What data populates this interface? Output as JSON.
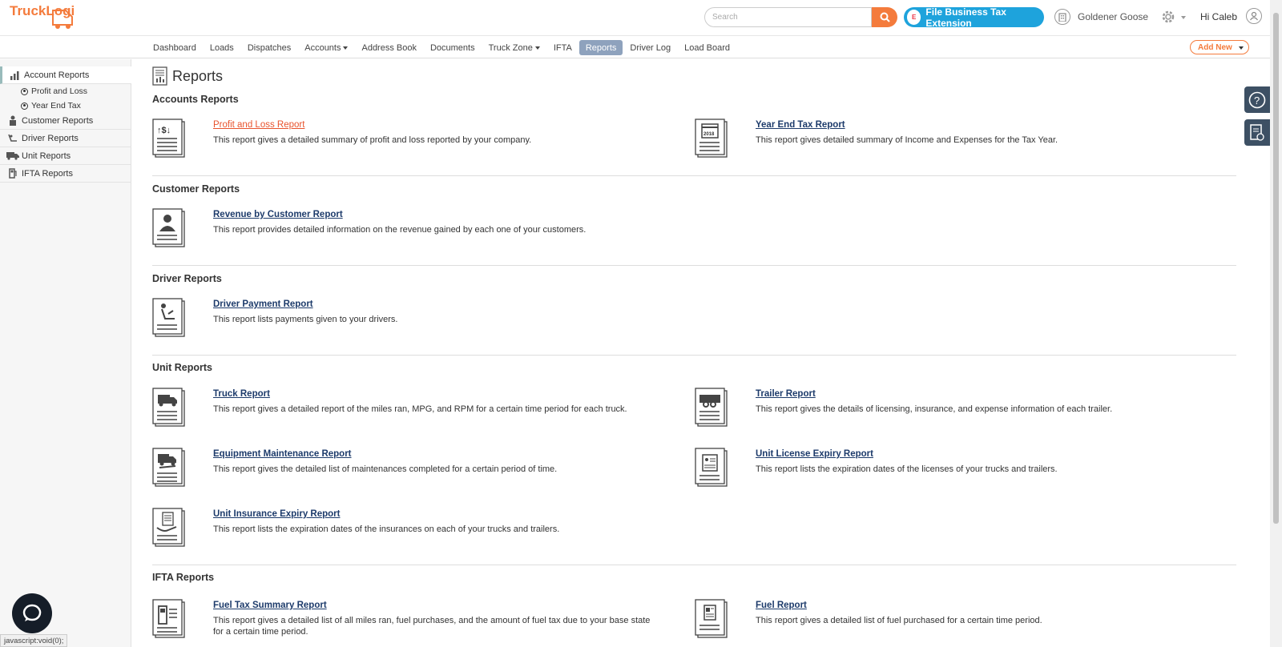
{
  "header": {
    "logo_text": "TruckLogics",
    "search_placeholder": "Search",
    "tax_button": "File Business Tax Extension",
    "tax_logo": "E",
    "company": "Goldener Goose",
    "greeting": "Hi Caleb"
  },
  "nav": {
    "items": [
      "Dashboard",
      "Loads",
      "Dispatches",
      "Accounts",
      "Address Book",
      "Documents",
      "Truck Zone",
      "IFTA",
      "Reports",
      "Driver Log",
      "Load Board"
    ],
    "active": "Reports",
    "add_new": "Add New"
  },
  "sidebar": {
    "items": [
      {
        "label": "Account Reports",
        "icon": "chart-icon"
      },
      {
        "label": "Customer Reports",
        "icon": "person-icon"
      },
      {
        "label": "Driver Reports",
        "icon": "driver-seat-icon"
      },
      {
        "label": "Unit Reports",
        "icon": "truck-icon"
      },
      {
        "label": "IFTA Reports",
        "icon": "fuel-pump-icon"
      }
    ],
    "subitems": [
      "Profit and Loss",
      "Year End Tax"
    ]
  },
  "main": {
    "title": "Reports",
    "sections": [
      {
        "title": "Accounts Reports"
      },
      {
        "title": "Customer Reports"
      },
      {
        "title": "Driver Reports"
      },
      {
        "title": "Unit Reports"
      },
      {
        "title": "IFTA Reports"
      }
    ],
    "reports": [
      {
        "title": "Profit and Loss Report",
        "desc": "This report gives a detailed summary of profit and loss reported by your company."
      },
      {
        "title": "Year End Tax Report",
        "desc": "This report gives detailed summary of Income and Expenses for the Tax Year.",
        "icon_text": "2018"
      },
      {
        "title": "Revenue by Customer Report",
        "desc": "This report provides detailed information on the revenue gained by each one of your customers."
      },
      {
        "title": "Driver Payment Report",
        "desc": "This report lists payments given to your drivers."
      },
      {
        "title": "Truck Report",
        "desc": "This report gives a detailed report of the miles ran, MPG, and RPM for a certain time period for each truck."
      },
      {
        "title": "Trailer Report",
        "desc": "This report gives the details of licensing, insurance, and expense information of each trailer."
      },
      {
        "title": "Equipment Maintenance Report",
        "desc": "This report gives the detailed list of maintenances completed for a certain period of time."
      },
      {
        "title": "Unit License Expiry Report",
        "desc": "This report lists the expiration dates of the licenses of your trucks and trailers."
      },
      {
        "title": "Unit Insurance Expiry Report",
        "desc": "This report lists the expiration dates of the insurances on each of your trucks and trailers."
      },
      {
        "title": "Fuel Tax Summary Report",
        "desc": "This report gives a detailed list of all miles ran, fuel purchases, and the amount of fuel tax due to your base state for a certain time period."
      },
      {
        "title": "Fuel Report",
        "desc": "This report gives a detailed list of fuel purchased for a certain time period."
      }
    ]
  },
  "status_bar": "javascript:void(0);",
  "colors": {
    "accent": "#f47b3c",
    "link": "#1d3b6b",
    "hover_link": "#e8532d",
    "active_nav": "#8ea2bd",
    "tax_blue": "#1ea3dc"
  }
}
